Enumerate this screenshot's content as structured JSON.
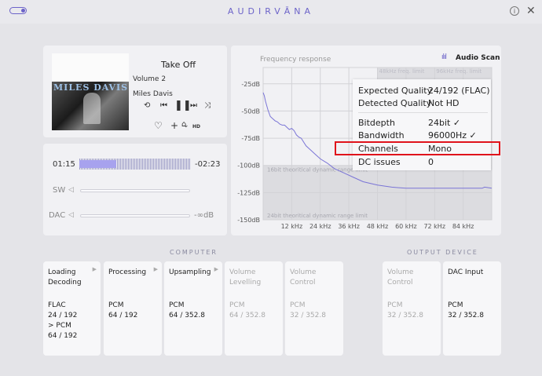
{
  "app": {
    "brand": "AUDIRVĀNA"
  },
  "player": {
    "album_art_title": "MILES DAVIS",
    "track_title": "Take Off",
    "volume": "Volume 2",
    "artist": "Miles Davis",
    "hd_badge": "HD",
    "elapsed": "01:15",
    "remaining": "-02:23",
    "progress": 0.33,
    "sw_label": "SW",
    "dac_label": "DAC",
    "dac_value": "-∞dB"
  },
  "frequency": {
    "title": "Frequency response",
    "scan_label": "Audio Scan",
    "limit_48": "48kHz freq. limit",
    "limit_96": "96kHz freq. limit",
    "limit_16bit": "16bit theoritical dynamic range limit",
    "limit_24bit": "24bit theoritical dynamic range limit",
    "chart_data": {
      "type": "line",
      "y_ticks": [
        "-25dB",
        "-50dB",
        "-75dB",
        "-100dB",
        "-125dB",
        "-150dB"
      ],
      "x_ticks": [
        "12 kHz",
        "24 kHz",
        "36 kHz",
        "48 kHz",
        "60 kHz",
        "72 kHz",
        "84 kHz"
      ],
      "xlim": [
        0,
        96
      ],
      "ylim": [
        -150,
        -10
      ],
      "grid": true,
      "series": [
        {
          "color": "#7a74d6",
          "x": [
            0,
            0.5,
            1,
            2,
            3,
            4,
            5,
            6,
            7,
            8,
            9,
            10,
            11,
            12,
            13,
            14,
            15,
            16,
            18,
            20,
            22,
            24,
            27,
            30,
            34,
            38,
            42,
            48,
            54,
            60,
            66,
            72,
            80,
            88,
            92,
            93,
            96
          ],
          "y": [
            -33,
            -36,
            -41,
            -49,
            -55,
            -57,
            -59,
            -60,
            -62,
            -63,
            -63,
            -65,
            -67,
            -66,
            -68,
            -72,
            -74,
            -75,
            -82,
            -86,
            -90,
            -94,
            -98,
            -103,
            -107,
            -111,
            -115,
            -118,
            -120,
            -121,
            -121,
            -121,
            -121,
            -121,
            -121,
            -120,
            -121
          ]
        }
      ]
    }
  },
  "scan": {
    "rows": [
      {
        "label": "Expected Quality",
        "value": "24/192 (FLAC)"
      },
      {
        "label": "Detected Quality",
        "value": "Not HD"
      },
      {
        "label": "Bitdepth",
        "value": "24bit ✓"
      },
      {
        "label": "Bandwidth",
        "value": "96000Hz ✓"
      },
      {
        "label": "Channels",
        "value": "Mono"
      },
      {
        "label": "DC issues",
        "value": "0"
      }
    ]
  },
  "pipeline": {
    "computer_label": "COMPUTER",
    "output_label": "OUTPUT DEVICE",
    "stages": [
      {
        "t1": "Loading",
        "t2": "Decoding",
        "f1": "FLAC",
        "f2": "24 / 192",
        "f3": "> PCM",
        "f4": "64 / 192"
      },
      {
        "t1": "Processing",
        "t2": "",
        "f1": "PCM",
        "f2": "64 / 192",
        "f3": "",
        "f4": ""
      },
      {
        "t1": "Upsampling",
        "t2": "",
        "f1": "PCM",
        "f2": "64 / 352.8",
        "f3": "",
        "f4": ""
      },
      {
        "t1": "Volume",
        "t2": "Levelling",
        "f1": "PCM",
        "f2": "64 / 352.8",
        "f3": "",
        "f4": ""
      },
      {
        "t1": "Volume",
        "t2": "Control",
        "f1": "PCM",
        "f2": "32 / 352.8",
        "f3": "",
        "f4": ""
      },
      {
        "t1": "Volume",
        "t2": "Control",
        "f1": "PCM",
        "f2": "32 / 352.8",
        "f3": "",
        "f4": ""
      },
      {
        "t1": "DAC Input",
        "t2": "",
        "f1": "PCM",
        "f2": "32 / 352.8",
        "f3": "",
        "f4": ""
      }
    ]
  }
}
